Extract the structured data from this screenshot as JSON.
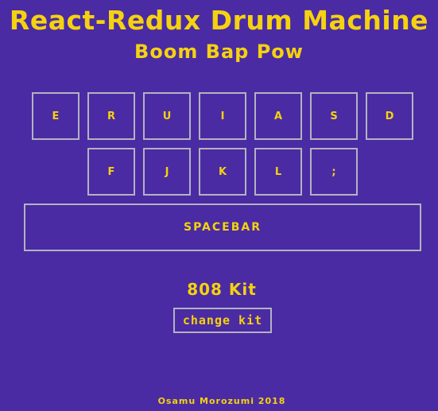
{
  "header": {
    "title": "React-Redux Drum Machine",
    "subtitle": "Boom Bap Pow"
  },
  "pads": {
    "row1": [
      "E",
      "R",
      "U",
      "I",
      "A",
      "S",
      "D"
    ],
    "row2": [
      "F",
      "J",
      "K",
      "L",
      ";"
    ],
    "spacebar": "SPACEBAR"
  },
  "kit": {
    "name": "808 Kit",
    "change_label": "change kit"
  },
  "footer": {
    "credit": "Osamu Morozumi 2018"
  },
  "colors": {
    "background": "#4a2ba3",
    "text": "#f5d20f",
    "border": "#b3b3c0"
  }
}
